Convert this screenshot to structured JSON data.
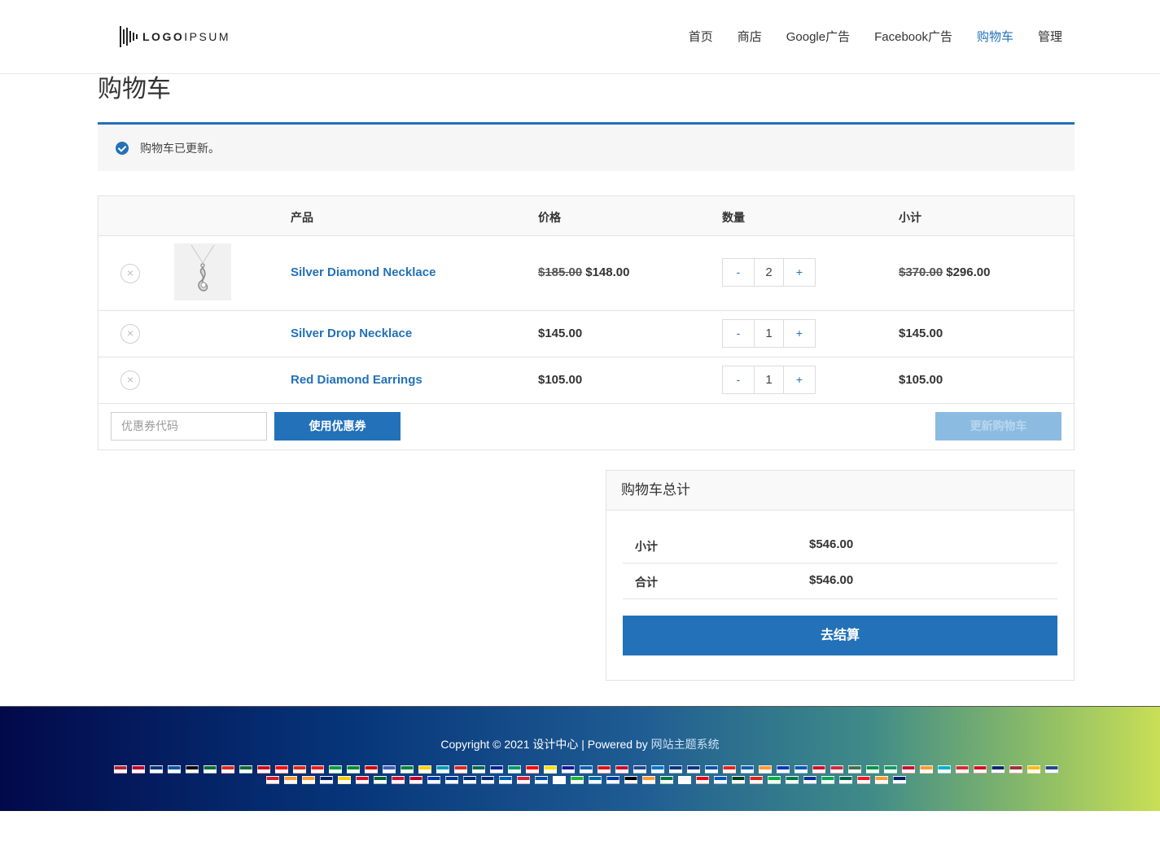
{
  "header": {
    "logo_text_bold": "LOGO",
    "logo_text_light": "IPSUM",
    "nav": [
      {
        "label": "首页",
        "active": false
      },
      {
        "label": "商店",
        "active": false
      },
      {
        "label": "Google广告",
        "active": false
      },
      {
        "label": "Facebook广告",
        "active": false
      },
      {
        "label": "购物车",
        "active": true
      },
      {
        "label": "管理",
        "active": false
      }
    ]
  },
  "page_title": "购物车",
  "notice": {
    "text": "购物车已更新。"
  },
  "cart_table": {
    "headers": {
      "product": "产品",
      "price": "价格",
      "quantity": "数量",
      "subtotal": "小计"
    },
    "items": [
      {
        "name": "Silver Diamond Necklace",
        "old_price": "$185.00",
        "price": "$148.00",
        "qty": "2",
        "old_subtotal": "$370.00",
        "subtotal": "$296.00"
      },
      {
        "name": "Silver Drop Necklace",
        "price": "$145.00",
        "qty": "1",
        "subtotal": "$145.00"
      },
      {
        "name": "Red Diamond Earrings",
        "price": "$105.00",
        "qty": "1",
        "subtotal": "$105.00"
      }
    ],
    "qty_minus": "-",
    "qty_plus": "+",
    "remove_symbol": "×",
    "coupon_placeholder": "优惠券代码",
    "apply_coupon": "使用优惠券",
    "update_cart": "更新购物车"
  },
  "totals": {
    "title": "购物车总计",
    "subtotal_label": "小计",
    "subtotal_value": "$546.00",
    "total_label": "合计",
    "total_value": "$546.00",
    "checkout": "去结算"
  },
  "footer": {
    "copyright": "Copyright © 2021 设计中心 | Powered by ",
    "powered_link": "网站主题系统",
    "flags": [
      "#b22234",
      "#bc002d",
      "#003478",
      "#0055a4",
      "#000000",
      "#006c35",
      "#d52b1e",
      "#046a38",
      "#c60b1e",
      "#fe0000",
      "#de2910",
      "#e41e20",
      "#009a44",
      "#078930",
      "#cc0000",
      "#3e5eb9",
      "#00843d",
      "#ffcc00",
      "#0099b5",
      "#d52b1e",
      "#006a4e",
      "#002395",
      "#00966e",
      "#fe0000",
      "#fcdd09",
      "#171796",
      "#0d5eaf",
      "#d7141a",
      "#c60c30",
      "#21468b",
      "#0072ce",
      "#003580",
      "#003580",
      "#0055a4",
      "#da291c",
      "#0d5eaf",
      "#ff9933",
      "#0038b8",
      "#0057b7",
      "#ce1126",
      "#cd2a3e",
      "#436f4d",
      "#009246",
      "#169b62",
      "#c8102e",
      "#ff9933",
      "#00afca",
      "#cd2e3a",
      "#ce1126",
      "#002868",
      "#9e3039",
      "#fdb913",
      "#21468b",
      "#ce2028",
      "#ff9933",
      "#ff9933",
      "#012169",
      "#ffce00",
      "#ce1126",
      "#006233",
      "#d21034",
      "#bc002d",
      "#0038a8",
      "#003893",
      "#002b7f",
      "#002b7f",
      "#005eb8",
      "#d4213d",
      "#0b4ea2",
      "#ffffff",
      "#1eb53a",
      "#006aa7",
      "#0038a8",
      "#000000",
      "#ff9933",
      "#007a3d",
      "#f4f5f8",
      "#e30a17",
      "#0057b7",
      "#01411c",
      "#da251d",
      "#00b140",
      "#007a4d",
      "#003399",
      "#00a651",
      "#006847",
      "#ed1c24",
      "#ff9933",
      "#012169"
    ]
  }
}
